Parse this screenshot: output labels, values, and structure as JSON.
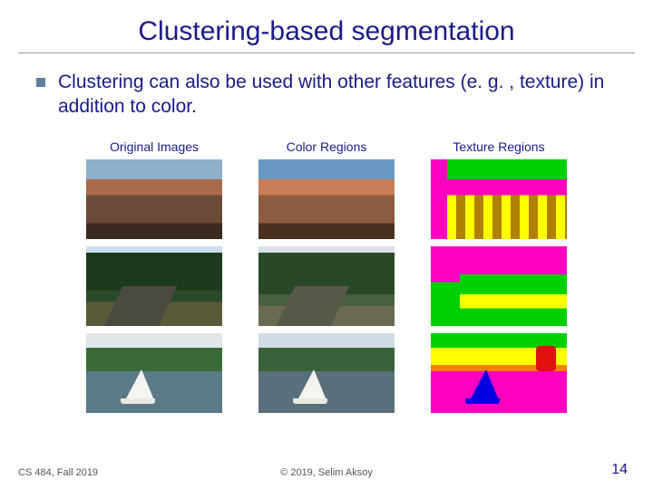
{
  "title": "Clustering-based segmentation",
  "body_text": "Clustering can also be used with other features (e. g. , texture) in addition to color.",
  "columns": {
    "original": "Original Images",
    "color": "Color Regions",
    "texture": "Texture Regions"
  },
  "footer": {
    "left": "CS 484, Fall 2019",
    "center": "© 2019, Selim Aksoy",
    "page": "14"
  }
}
